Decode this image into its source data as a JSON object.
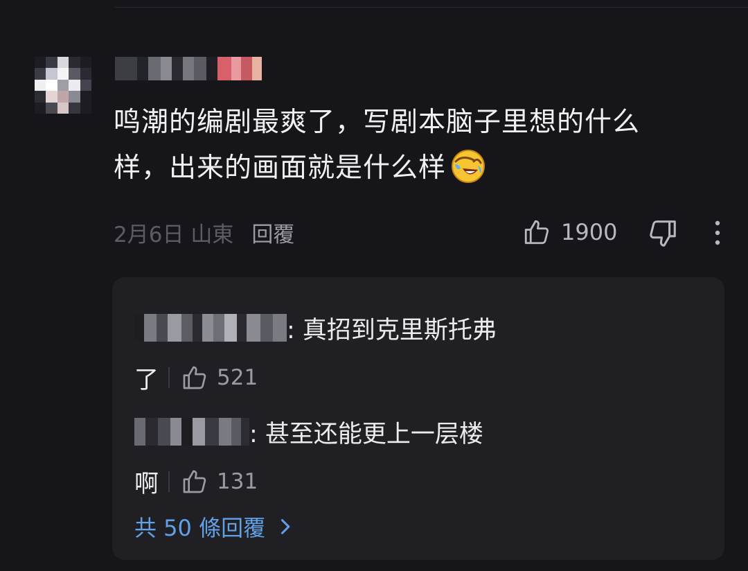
{
  "comment": {
    "text_line1": "鸣潮的编剧最爽了，写剧本脑子里想的什么",
    "text_line2": "样，出来的画面就是什么样",
    "emoji": "laughing-crying-face-emoji",
    "date": "2月6日",
    "location": "山東",
    "reply_label": "回覆",
    "like_count": "1900"
  },
  "replies": [
    {
      "text_line1": ": 真招到克里斯托弗",
      "text_line2": "了",
      "like_count": "521"
    },
    {
      "text_line1": ": 甚至还能更上一层楼",
      "text_line2": "啊",
      "like_count": "131"
    }
  ],
  "view_more_label": "共 50 條回覆",
  "icons": {
    "like": "thumbs-up-icon",
    "dislike": "thumbs-down-icon",
    "more": "more-vertical-icon",
    "chevron": "chevron-right-icon"
  },
  "colors": {
    "background": "#16161a",
    "reply_panel": "#202024",
    "link_blue": "#62a1e6"
  }
}
